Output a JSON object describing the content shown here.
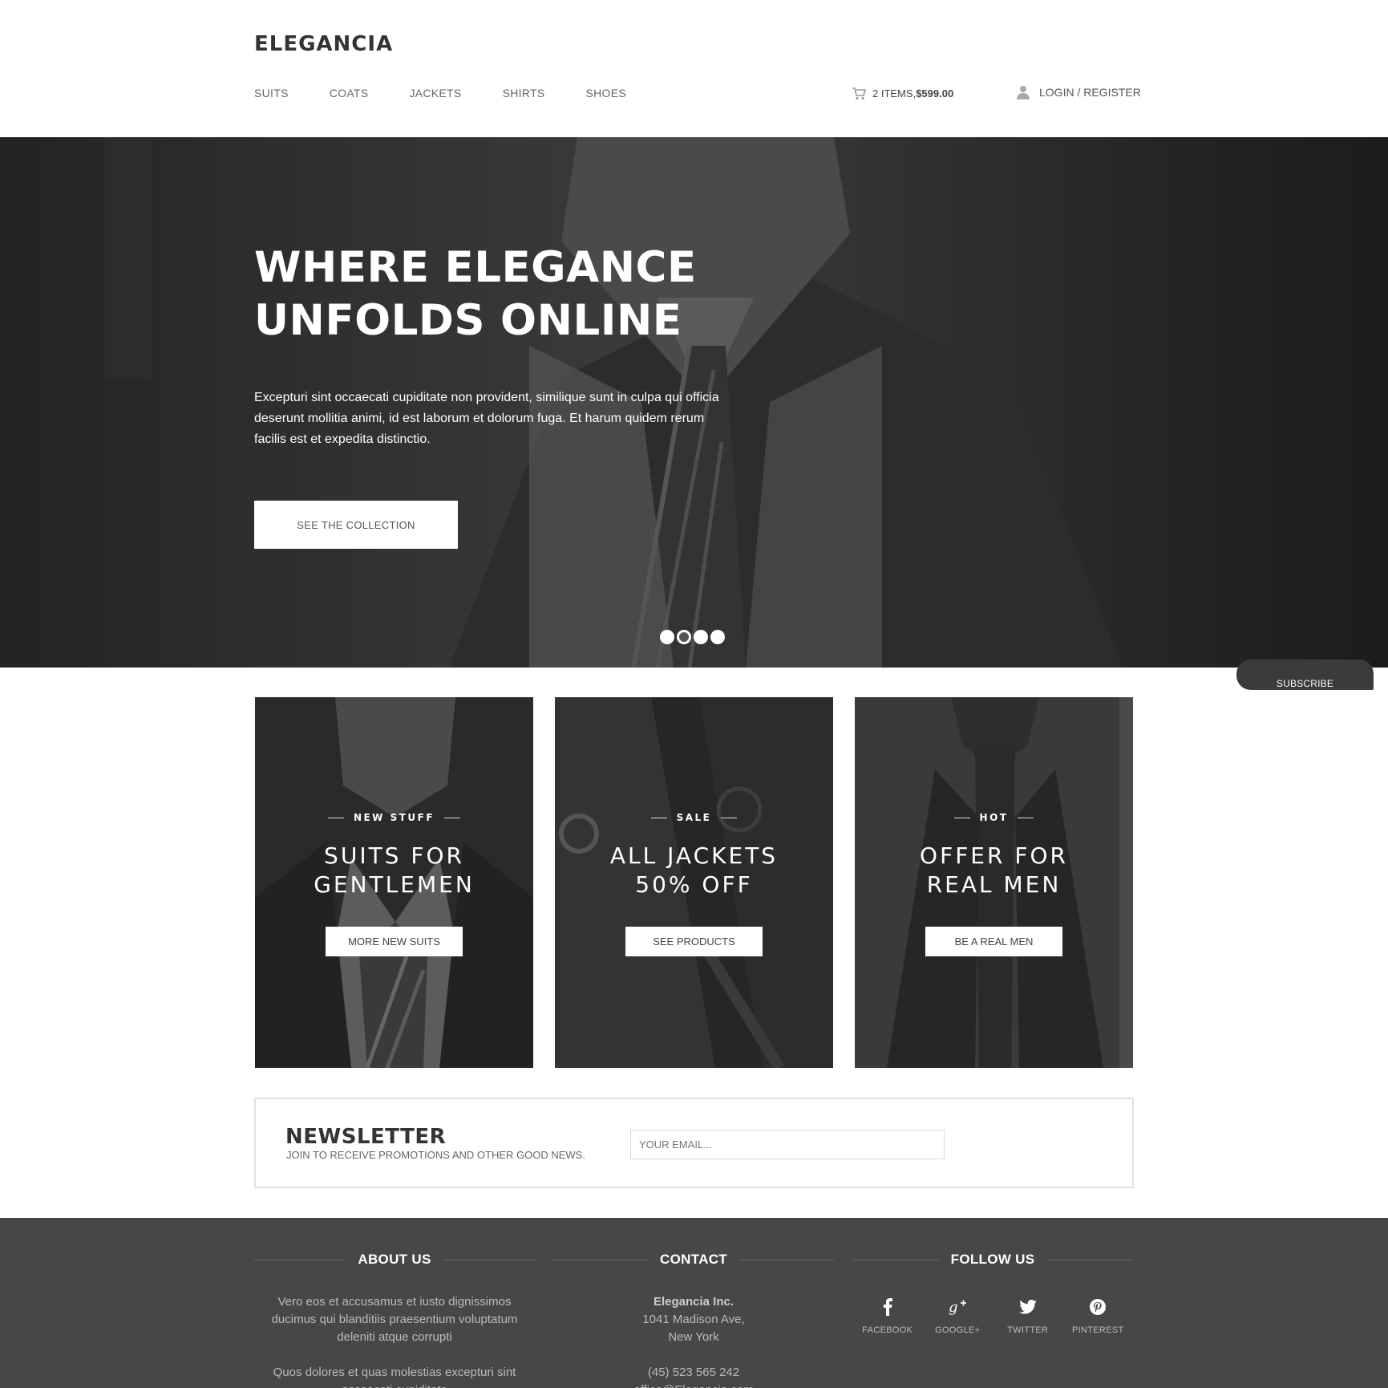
{
  "brand": {
    "logo": "ELEGANCIA"
  },
  "nav": {
    "items": [
      {
        "label": "SUITS"
      },
      {
        "label": "COATS"
      },
      {
        "label": "JACKETS"
      },
      {
        "label": "SHIRTS"
      },
      {
        "label": "SHOES"
      }
    ]
  },
  "cart": {
    "label": "2 ITEMS, ",
    "price": "$599.00"
  },
  "account": {
    "label": "LOGIN / REGISTER"
  },
  "hero": {
    "title_line1": "WHERE ELEGANCE",
    "title_line2": "UNFOLDS ONLINE",
    "text": "Excepturi sint occaecati cupiditate non provident, similique sunt in culpa qui officia deserunt mollitia animi, id est laborum et dolorum fuga. Et harum quidem rerum facilis est et expedita distinctio.",
    "button": "SEE THE COLLECTION",
    "slides_total": 4,
    "active_slide": 2
  },
  "subscribe_tab": {
    "label": "SUBSCRIBE"
  },
  "promos": [
    {
      "tag": "NEW STUFF",
      "line1": "SUITS FOR",
      "line2": "GENTLEMEN",
      "button": "MORE NEW SUITS"
    },
    {
      "tag": "SALE",
      "line1": "ALL JACKETS",
      "line2": "50% OFF",
      "button": "SEE PRODUCTS"
    },
    {
      "tag": "HOT",
      "line1": "OFFER FOR",
      "line2": "REAL MEN",
      "button": "BE A REAL MEN"
    }
  ],
  "newsletter": {
    "title": "NEWSLETTER",
    "subtitle": "JOIN TO RECEIVE PROMOTIONS AND OTHER GOOD NEWS.",
    "placeholder": "YOUR EMAIL..."
  },
  "footer": {
    "about": {
      "heading": "ABOUT US",
      "p1": "Vero eos et accusamus et iusto dignissimos ducimus qui blanditiis praesentium voluptatum deleniti atque corrupti",
      "p2": "Quos dolores et quas molestias excepturi sint occaecati cupiditate"
    },
    "contact": {
      "heading": "CONTACT",
      "company": "Elegancia Inc.",
      "address1": "1041 Madison Ave,",
      "address2": "New York",
      "phone": "(45) 523 565 242",
      "email": "office@Elegancia.com"
    },
    "follow": {
      "heading": "FOLLOW US",
      "items": [
        {
          "label": "FACEBOOK",
          "icon": "facebook-icon"
        },
        {
          "label": "GOOGLE+",
          "icon": "google-plus-icon"
        },
        {
          "label": "TWITTER",
          "icon": "twitter-icon"
        },
        {
          "label": "PINTEREST",
          "icon": "pinterest-icon"
        }
      ]
    }
  },
  "colors": {
    "hero_dark": "#2b2b2b",
    "footer_bg": "#474747",
    "text_dark": "#333333",
    "button_bg": "#ffffff"
  }
}
